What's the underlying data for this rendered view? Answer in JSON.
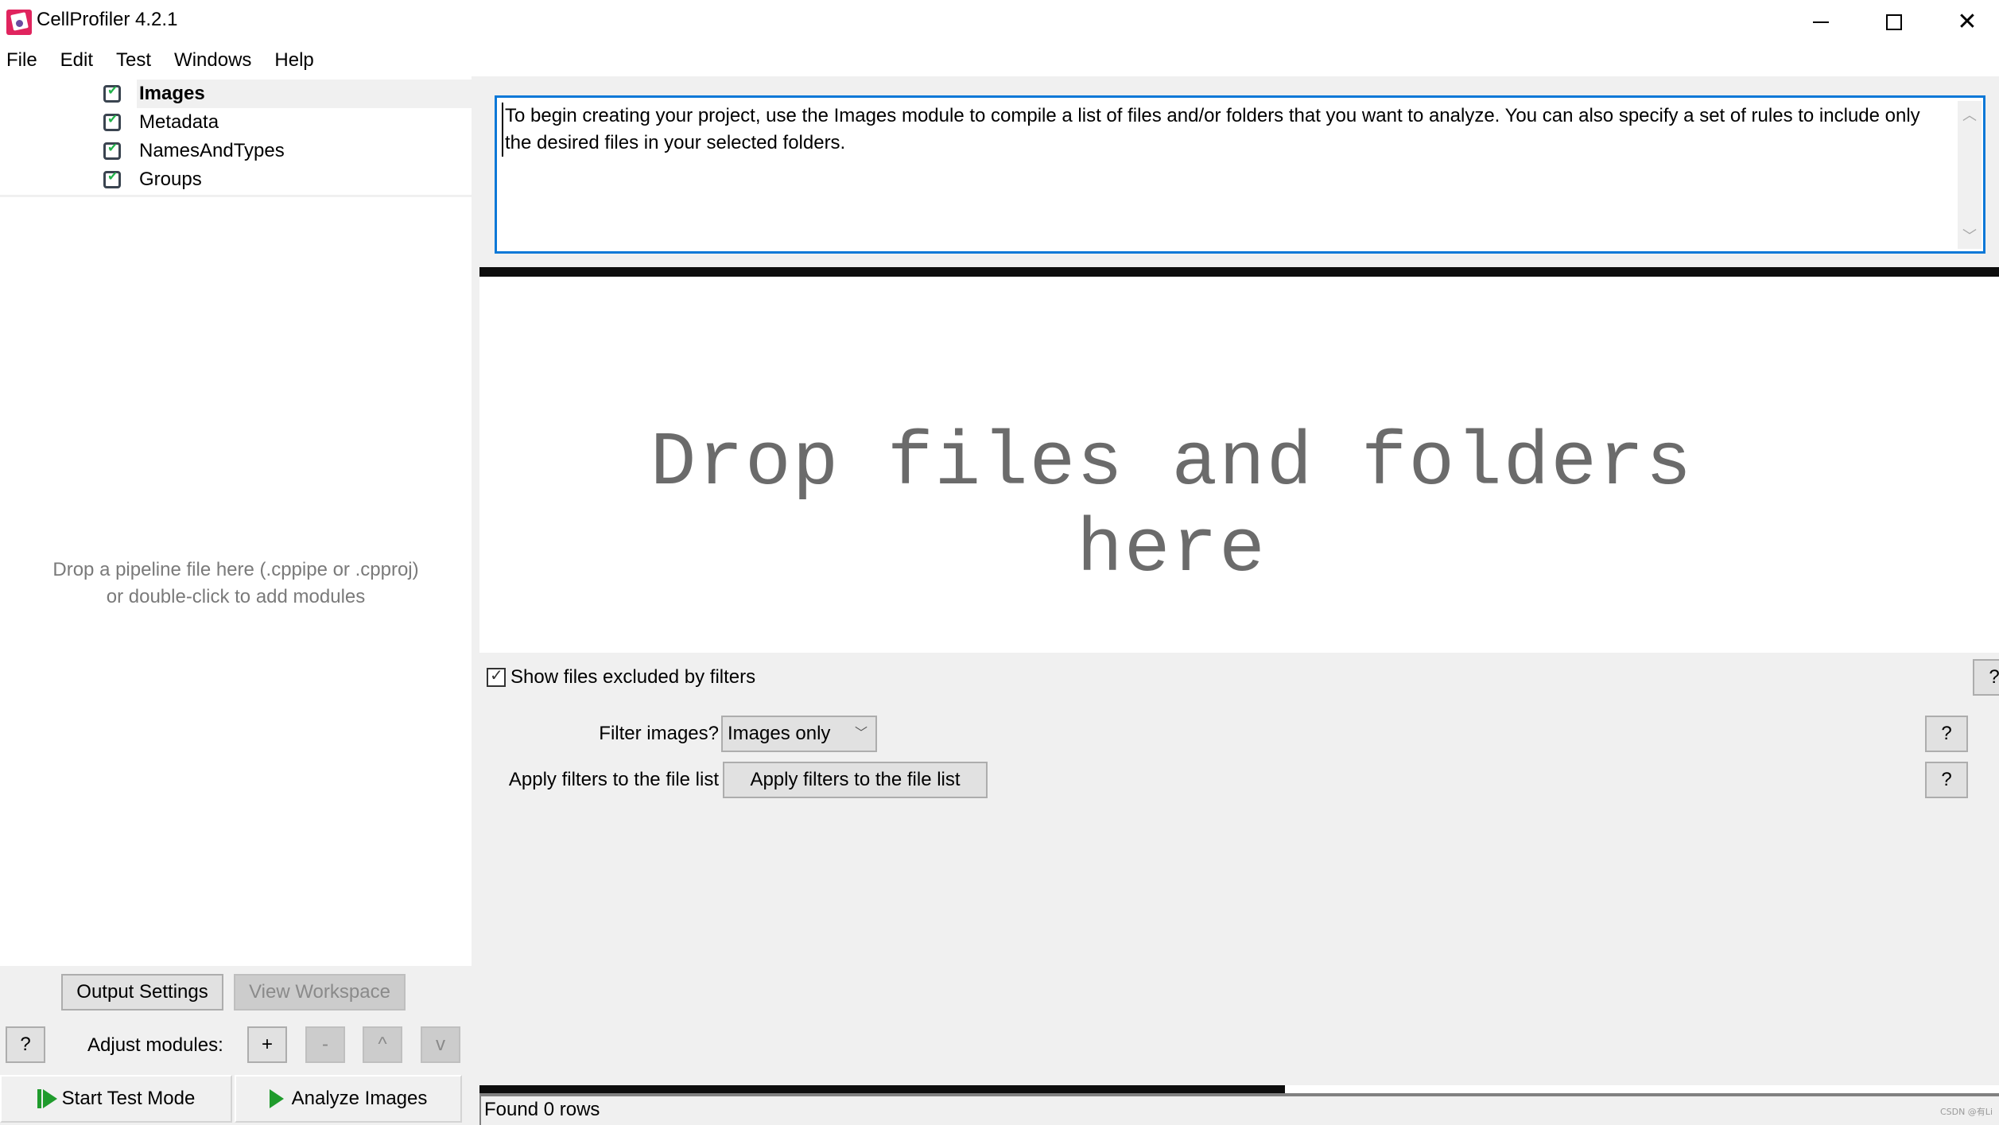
{
  "window": {
    "title": "CellProfiler 4.2.1",
    "icon": "cellprofiler-logo-icon",
    "controls": {
      "minimize": "minimize-icon",
      "maximize": "maximize-icon",
      "close": "close-icon",
      "close_glyph": "✕"
    }
  },
  "menu": [
    "File",
    "Edit",
    "Test",
    "Windows",
    "Help"
  ],
  "pipeline": {
    "modules": [
      {
        "label": "Images",
        "enabled": true,
        "selected": true
      },
      {
        "label": "Metadata",
        "enabled": true,
        "selected": false
      },
      {
        "label": "NamesAndTypes",
        "enabled": true,
        "selected": false
      },
      {
        "label": "Groups",
        "enabled": true,
        "selected": false
      }
    ],
    "hint_line1": "Drop a pipeline file here (.cppipe or .cpproj)",
    "hint_line2": "or double-click to add modules"
  },
  "left_controls": {
    "output_settings": "Output Settings",
    "view_workspace": "View Workspace",
    "help": "?",
    "adjust_label": "Adjust modules:",
    "add": "+",
    "remove": "-",
    "move_up": "^",
    "move_down": "v",
    "start_test_mode": "Start Test Mode",
    "analyze_images": "Analyze Images"
  },
  "images_module": {
    "help_text": "To begin creating your project, use the Images module to compile a list of files and/or folders that you want to analyze. You can also specify a set of rules to include only the desired files in your selected folders.",
    "drop_text": "Drop files and folders here",
    "show_excluded_label": "Show files excluded by filters",
    "show_excluded_checked": true,
    "filter_label": "Filter images?",
    "filter_value": "Images only",
    "apply_label": "Apply filters to the file list",
    "apply_button": "Apply filters to the file list",
    "help_button": "?"
  },
  "status": {
    "text": "Found 0 rows",
    "progress_fraction": 0.53
  },
  "watermark": "CSDN @有Li"
}
